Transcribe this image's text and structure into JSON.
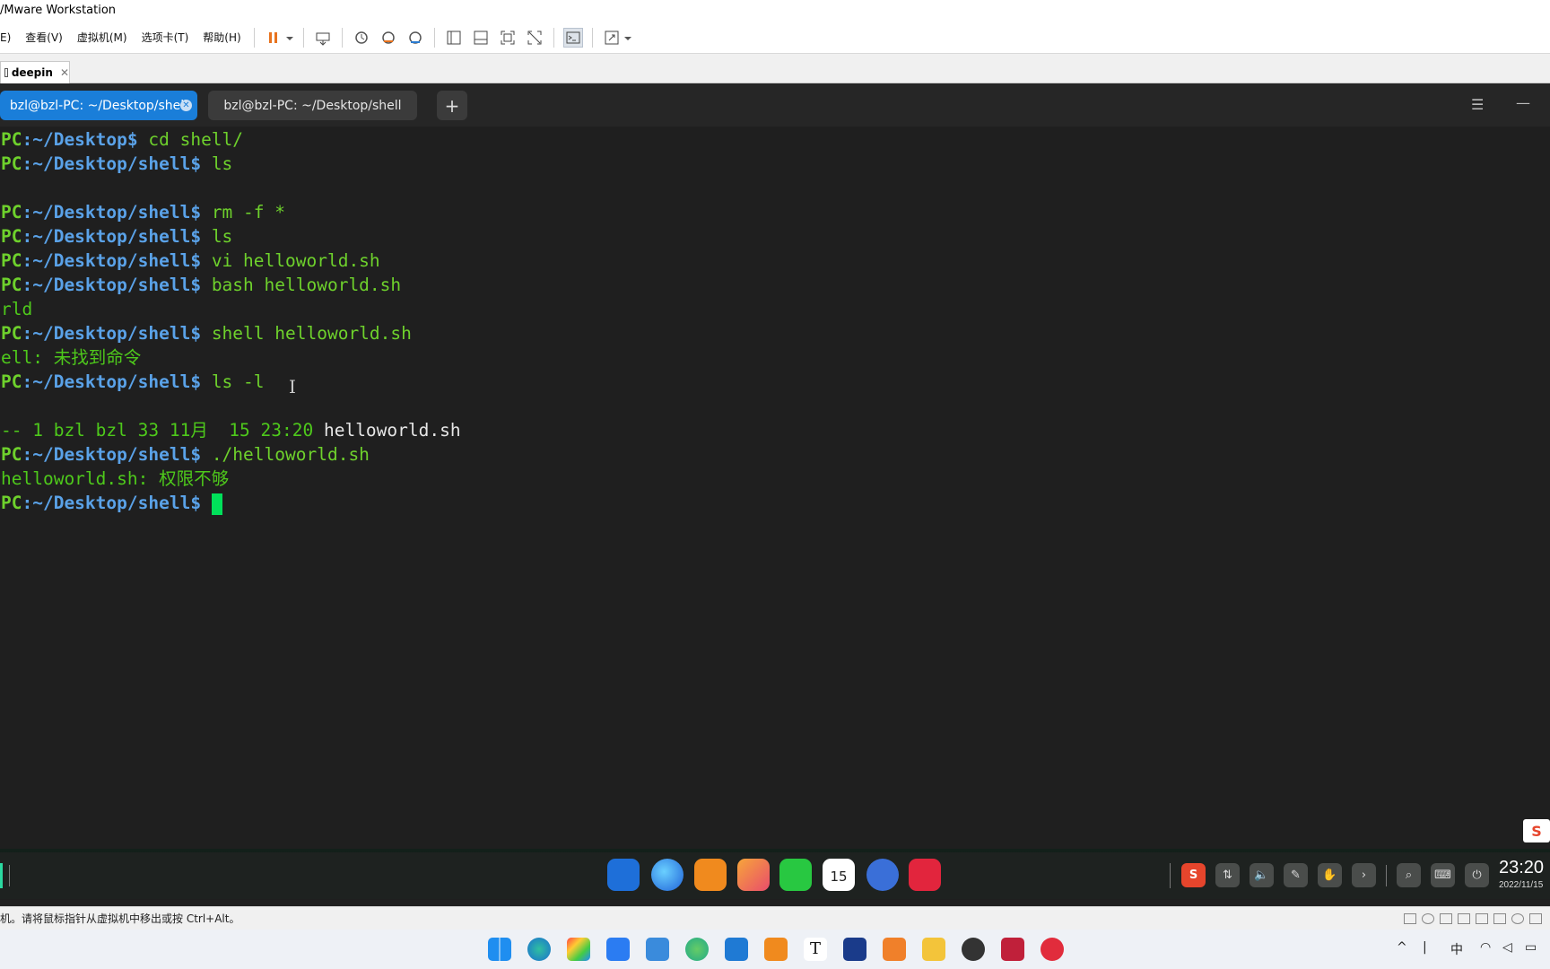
{
  "vm": {
    "title": "/Mware Workstation",
    "menus": [
      "E)",
      "查看(V)",
      "虚拟机(M)",
      "选项卡(T)",
      "帮助(H)"
    ],
    "tab_name": "deepin",
    "tab_close": "✕",
    "status_text": "机。请将鼠标指针从虚拟机中移出或按 Ctrl+Alt。"
  },
  "terminal": {
    "tabs": [
      {
        "label": "bzl@bzl-PC: ~/Desktop/shell",
        "active": true,
        "close": "✕"
      },
      {
        "label": "bzl@bzl-PC: ~/Desktop/shell",
        "active": false
      }
    ],
    "add_tab": "+",
    "menu_glyph": "☰",
    "minimize_glyph": "—",
    "lines": [
      {
        "pc": "PC",
        "path": ":~/Desktop$",
        "cmd": " cd shell/"
      },
      {
        "pc": "PC",
        "path": ":~/Desktop/shell$",
        "cmd": " ls"
      },
      {
        "out": ""
      },
      {
        "pc": "PC",
        "path": ":~/Desktop/shell$",
        "cmd": " rm -f *"
      },
      {
        "pc": "PC",
        "path": ":~/Desktop/shell$",
        "cmd": " ls"
      },
      {
        "pc": "PC",
        "path": ":~/Desktop/shell$",
        "cmd": " vi helloworld.sh"
      },
      {
        "pc": "PC",
        "path": ":~/Desktop/shell$",
        "cmd": " bash helloworld.sh"
      },
      {
        "out": "rld"
      },
      {
        "pc": "PC",
        "path": ":~/Desktop/shell$",
        "cmd": " shell helloworld.sh"
      },
      {
        "out": "ell: 未找到命令"
      },
      {
        "pc": "PC",
        "path": ":~/Desktop/shell$",
        "cmd": " ls -l"
      },
      {
        "out": ""
      },
      {
        "out": "-- 1 bzl bzl 33 11月  15 23:20 ",
        "file": "helloworld.sh"
      },
      {
        "pc": "PC",
        "path": ":~/Desktop/shell$",
        "cmd": " ./helloworld.sh"
      },
      {
        "out": "helloworld.sh: 权限不够"
      },
      {
        "pc": "PC",
        "path": ":~/Desktop/shell$",
        "cmd": " ",
        "cursor": true
      }
    ]
  },
  "guest_dock": {
    "calendar_day": "15",
    "time": "23:20",
    "date": "2022/11/15",
    "sogou": "S",
    "tray_glyphs": [
      "S",
      "⇅",
      "🔈",
      "✎",
      "✋",
      "›",
      "⌕",
      "⌨",
      "⏻"
    ]
  },
  "host_taskbar": {
    "ime": "中",
    "apps": [
      "start",
      "edge",
      "app3",
      "todo",
      "app5",
      "browser",
      "vscode",
      "vmware",
      "typora",
      "devcpp",
      "sublime",
      "explorer",
      "obs",
      "app14",
      "netease-music"
    ]
  },
  "colors": {
    "terminal_bg": "#1f1f1f",
    "prompt_path": "#5aa2e8",
    "prompt_pc": "#6ed12c",
    "output": "#4ec91b",
    "active_tab": "#1a7ed9"
  }
}
